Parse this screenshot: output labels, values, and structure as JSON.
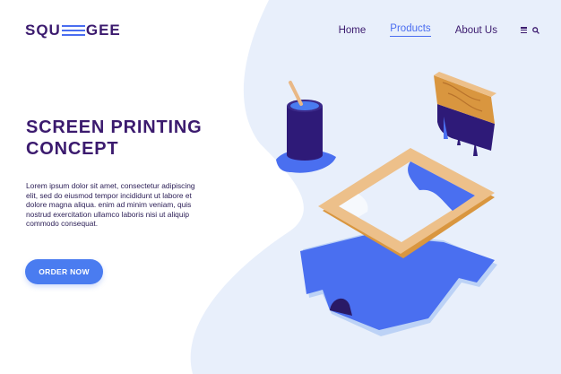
{
  "header": {
    "logo_left": "SQU",
    "logo_right": "GEE",
    "nav": [
      "Home",
      "Products",
      "About Us"
    ],
    "active_nav": "Products",
    "icons": [
      "menu-icon",
      "search-icon"
    ]
  },
  "hero": {
    "title": "SCREEN PRINTING CONCEPT",
    "body": "Lorem ipsum dolor sit amet, consectetur adipiscing elit, sed do eiusmod tempor incididunt ut labore et dolore magna aliqua. enim ad minim veniam, quis nostrud exercitation ullamco laboris nisi ut aliquip commodo consequat.",
    "cta": "ORDER NOW"
  },
  "colors": {
    "brand": "#3b1a6e",
    "accent": "#4a7cf0",
    "background_blob": "#e8effb",
    "wood": "#e9b886"
  }
}
